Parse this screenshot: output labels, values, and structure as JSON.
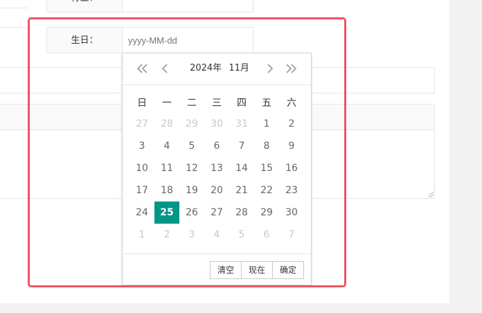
{
  "form": {
    "top_label": "行业：",
    "birthday_label": "生日：",
    "birthday_value": "",
    "birthday_placeholder": "yyyy-MM-dd"
  },
  "datepicker": {
    "year": "2024年",
    "month": "11月",
    "weekdays": [
      "日",
      "一",
      "二",
      "三",
      "四",
      "五",
      "六"
    ],
    "selected_day": "25",
    "weeks": [
      [
        {
          "d": "27",
          "other": true
        },
        {
          "d": "28",
          "other": true
        },
        {
          "d": "29",
          "other": true
        },
        {
          "d": "30",
          "other": true
        },
        {
          "d": "31",
          "other": true
        },
        {
          "d": "1"
        },
        {
          "d": "2"
        }
      ],
      [
        {
          "d": "3"
        },
        {
          "d": "4"
        },
        {
          "d": "5"
        },
        {
          "d": "6"
        },
        {
          "d": "7"
        },
        {
          "d": "8"
        },
        {
          "d": "9"
        }
      ],
      [
        {
          "d": "10"
        },
        {
          "d": "11"
        },
        {
          "d": "12"
        },
        {
          "d": "13"
        },
        {
          "d": "14"
        },
        {
          "d": "15"
        },
        {
          "d": "16"
        }
      ],
      [
        {
          "d": "17"
        },
        {
          "d": "18"
        },
        {
          "d": "19"
        },
        {
          "d": "20"
        },
        {
          "d": "21"
        },
        {
          "d": "22"
        },
        {
          "d": "23"
        }
      ],
      [
        {
          "d": "24"
        },
        {
          "d": "25"
        },
        {
          "d": "26"
        },
        {
          "d": "27"
        },
        {
          "d": "28"
        },
        {
          "d": "29"
        },
        {
          "d": "30"
        }
      ],
      [
        {
          "d": "1",
          "other": true
        },
        {
          "d": "2",
          "other": true
        },
        {
          "d": "3",
          "other": true
        },
        {
          "d": "4",
          "other": true
        },
        {
          "d": "5",
          "other": true
        },
        {
          "d": "6",
          "other": true
        },
        {
          "d": "7",
          "other": true
        }
      ]
    ],
    "buttons": {
      "clear": "清空",
      "now": "现在",
      "confirm": "确定"
    },
    "icons": {
      "prev_year": "double-chevron-left-icon",
      "prev_month": "chevron-left-icon",
      "next_month": "chevron-right-icon",
      "next_year": "double-chevron-right-icon"
    }
  },
  "colors": {
    "selected_bg": "#009688",
    "highlight_border": "#ee5564"
  }
}
